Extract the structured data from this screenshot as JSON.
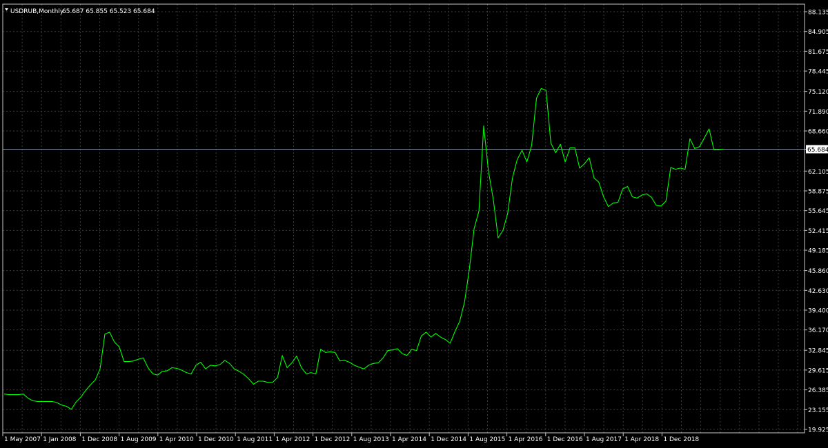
{
  "chart_data": {
    "type": "line",
    "header": {
      "symbol": "USDRUB,Monthly",
      "ohlc": "65.687 65.855 65.523 65.684"
    },
    "current_price_label": "65.684",
    "ylim": [
      19.925,
      88.135
    ],
    "y_ticks": [
      "88.135",
      "84.905",
      "81.675",
      "78.445",
      "75.120",
      "71.890",
      "68.660",
      "65.684",
      "62.105",
      "58.875",
      "55.645",
      "52.415",
      "49.185",
      "45.860",
      "42.630",
      "39.400",
      "36.170",
      "32.845",
      "29.615",
      "26.385",
      "23.155",
      "19.925"
    ],
    "x_ticks": [
      "1 May 2007",
      "1 Jan 2008",
      "1 Dec 2008",
      "1 Aug 2009",
      "1 Apr 2010",
      "1 Dec 2010",
      "1 Aug 2011",
      "1 Apr 2012",
      "1 Dec 2012",
      "1 Aug 2013",
      "1 Apr 2014",
      "1 Dec 2014",
      "1 Aug 2015",
      "1 Apr 2016",
      "1 Dec 2016",
      "1 Aug 2017",
      "1 Apr 2018",
      "1 Dec 2018"
    ],
    "grid": true,
    "series": [
      {
        "values": [
          25.7,
          25.6,
          25.6,
          25.6,
          25.7,
          25.0,
          24.6,
          24.5,
          24.5,
          24.5,
          24.5,
          24.3,
          23.9,
          23.7,
          23.2,
          24.4,
          25.2,
          26.3,
          27.2,
          28.0,
          29.8,
          35.5,
          35.8,
          34.2,
          33.4,
          31.0,
          31.0,
          31.1,
          31.4,
          31.6,
          30.0,
          29.0,
          28.8,
          29.4,
          29.5,
          30.0,
          29.9,
          29.6,
          29.2,
          29.0,
          30.4,
          30.9,
          29.8,
          30.4,
          30.3,
          30.5,
          31.2,
          30.7,
          29.8,
          29.4,
          28.9,
          28.2,
          27.3,
          27.8,
          27.8,
          27.6,
          27.6,
          28.4,
          32.0,
          30.0,
          30.8,
          31.9,
          30.0,
          29.0,
          29.2,
          29.0,
          33.0,
          32.5,
          32.6,
          32.5,
          31.1,
          31.2,
          30.9,
          30.4,
          30.1,
          29.8,
          30.4,
          30.7,
          30.8,
          31.6,
          32.8,
          32.9,
          33.1,
          32.3,
          32.0,
          33.0,
          32.8,
          35.2,
          35.8,
          35.0,
          35.6,
          35.0,
          34.6,
          34.0,
          35.9,
          37.6,
          40.7,
          46.0,
          52.7,
          55.6,
          69.5,
          62.0,
          57.5,
          51.2,
          52.4,
          55.2,
          61.0,
          64.0,
          65.5,
          63.6,
          66.3,
          74.0,
          75.6,
          75.3,
          66.7,
          65.1,
          66.5,
          63.6,
          65.9,
          65.9,
          62.6,
          63.3,
          64.3,
          61.0,
          60.3,
          57.9,
          56.3,
          56.9,
          57.0,
          59.2,
          59.6,
          57.9,
          57.7,
          58.2,
          58.4,
          57.8,
          56.5,
          56.4,
          57.2,
          62.7,
          62.4,
          62.6,
          62.4,
          67.4,
          65.8,
          66.1,
          67.5,
          69.0,
          65.6,
          65.6,
          65.7
        ],
        "x_start": "2007-05",
        "interval": "monthly"
      }
    ],
    "colors": {
      "background": "#000000",
      "line": "#00ff00",
      "grid": "#3c3c3c",
      "price_line": "#8090a0",
      "axis": "#c8c8c8",
      "text": "#ffffff"
    }
  }
}
